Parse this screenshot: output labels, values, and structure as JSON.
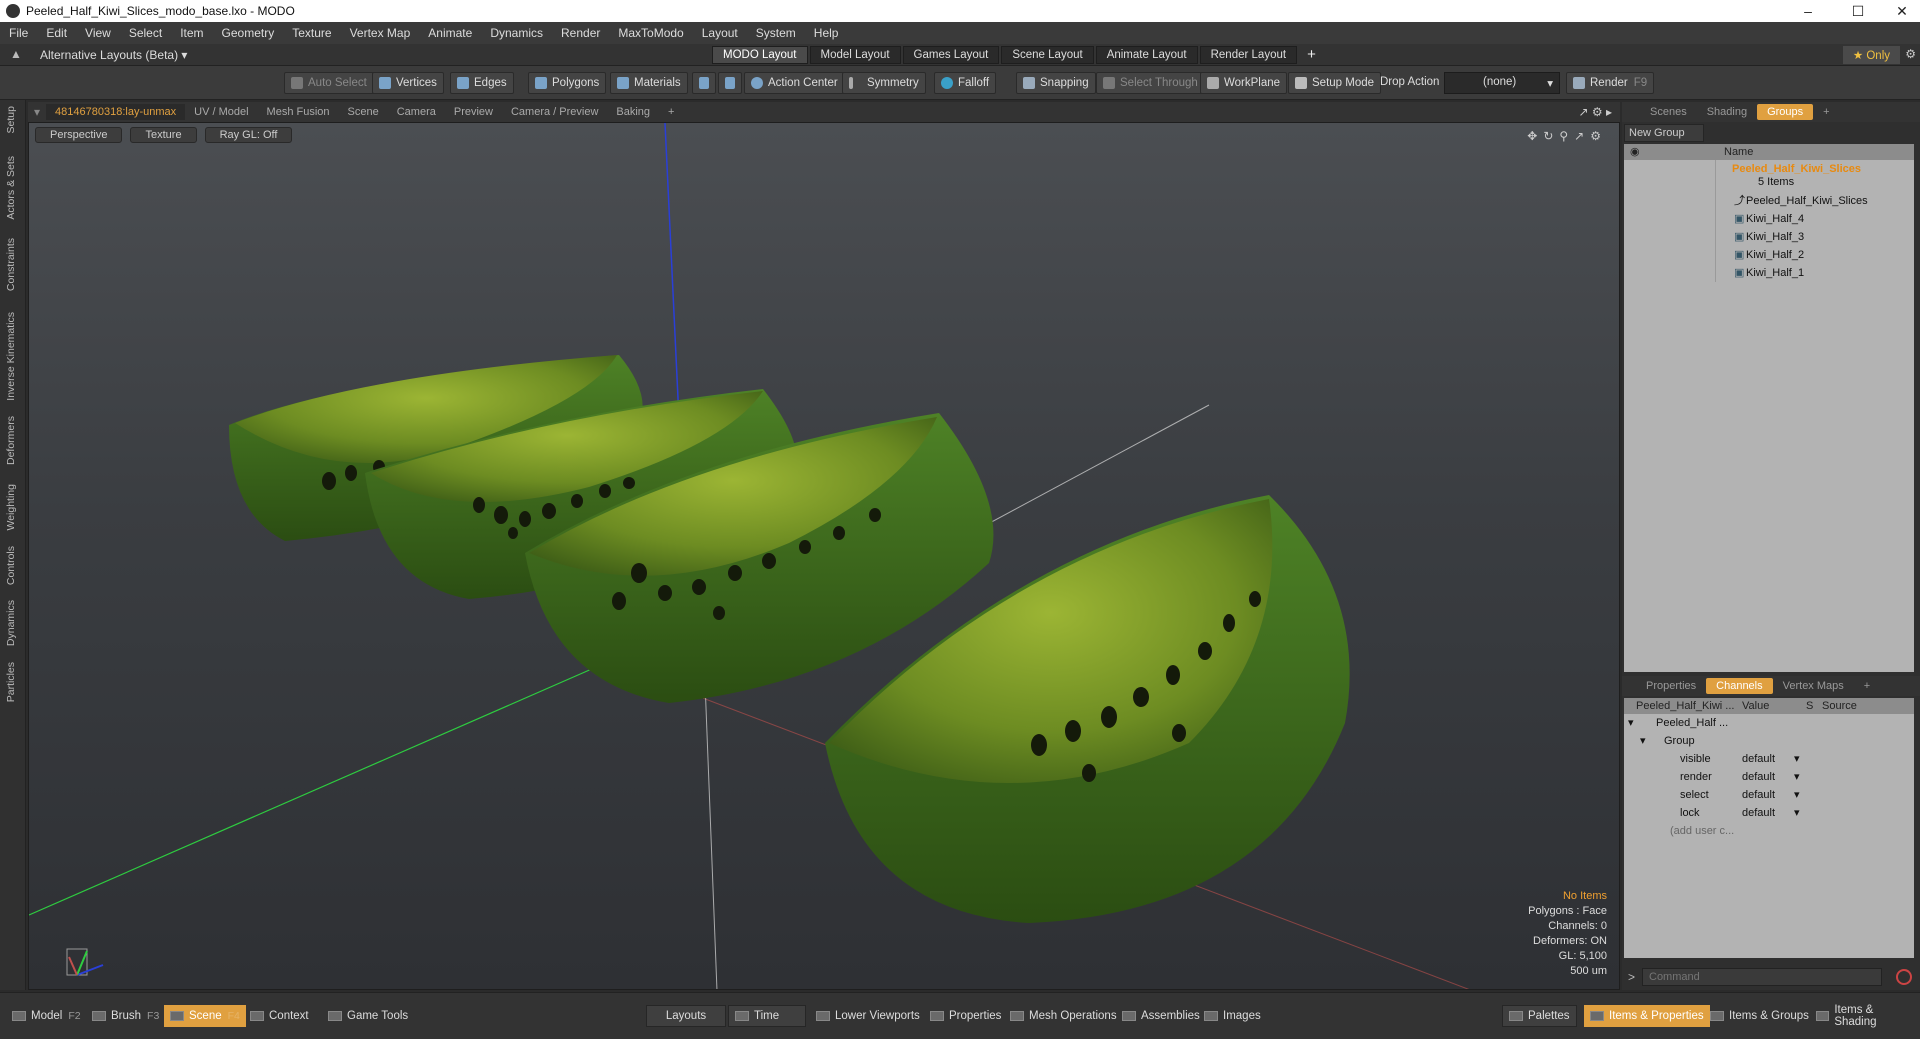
{
  "window": {
    "title": "Peeled_Half_Kiwi_Slices_modo_base.lxo - MODO",
    "minimize": "–",
    "maximize": "☐",
    "close": "✕"
  },
  "menu": [
    "File",
    "Edit",
    "View",
    "Select",
    "Item",
    "Geometry",
    "Texture",
    "Vertex Map",
    "Animate",
    "Dynamics",
    "Render",
    "MaxToModo",
    "Layout",
    "System",
    "Help"
  ],
  "layoutbar": {
    "alternative": "Alternative Layouts (Beta) ▾",
    "tabs": [
      "MODO Layout",
      "Model Layout",
      "Games Layout",
      "Scene Layout",
      "Animate Layout",
      "Render Layout"
    ],
    "add": "+",
    "only": "★ Only"
  },
  "toolbar": {
    "auto_select": "Auto Select",
    "vertices": "Vertices",
    "edges": "Edges",
    "polygons": "Polygons",
    "materials": "Materials",
    "action_center": "Action Center",
    "symmetry": "Symmetry",
    "falloff": "Falloff",
    "snapping": "Snapping",
    "select_through": "Select Through",
    "workplane": "WorkPlane",
    "setup_mode": "Setup Mode",
    "drop_action": "Drop Action",
    "drop_value": "(none)",
    "render": "Render",
    "render_key": "F9"
  },
  "lefttabs": [
    "Setup",
    "Actors & Sets",
    "Constraints",
    "Inverse Kinematics",
    "Deformers",
    "Weighting",
    "Controls",
    "Dynamics",
    "Particles"
  ],
  "viewport_tabs": [
    "48146780318:lay-unmax",
    "UV / Model",
    "Mesh Fusion",
    "Scene",
    "Camera",
    "Preview",
    "Camera / Preview",
    "Baking",
    "+"
  ],
  "viewport": {
    "view": "Perspective",
    "shading": "Texture",
    "raygl": "Ray GL: Off",
    "info": {
      "items": "No Items",
      "polygons": "Polygons : Face",
      "channels": "Channels: 0",
      "deformers": "Deformers: ON",
      "gl": "GL: 5,100",
      "scale": "500 um"
    }
  },
  "scene_panel": {
    "tabs": [
      "Scenes",
      "Shading",
      "Groups",
      "+"
    ],
    "new_group": "New Group",
    "name_header": "Name",
    "group_name": "Peeled_Half_Kiwi_Slices",
    "group_count": "5 Items",
    "children": [
      "Peeled_Half_Kiwi_Slices",
      "Kiwi_Half_4",
      "Kiwi_Half_3",
      "Kiwi_Half_2",
      "Kiwi_Half_1"
    ]
  },
  "props_panel": {
    "tabs": [
      "Properties",
      "Channels",
      "Vertex Maps",
      "+"
    ],
    "headers": {
      "name": "Peeled_Half_Kiwi ...",
      "value": "Value",
      "s": "S",
      "source": "Source"
    },
    "item": "Peeled_Half ...",
    "group": "Group",
    "rows": [
      {
        "name": "visible",
        "value": "default"
      },
      {
        "name": "render",
        "value": "default"
      },
      {
        "name": "select",
        "value": "default"
      },
      {
        "name": "lock",
        "value": "default"
      }
    ],
    "add_user": "(add user c...",
    "command_placeholder": "Command",
    "command_prompt": ">"
  },
  "statusbar": {
    "model": "Model",
    "model_key": "F2",
    "brush": "Brush",
    "brush_key": "F3",
    "scene": "Scene",
    "scene_key": "F4",
    "context": "Context",
    "game_tools": "Game Tools",
    "layouts": "Layouts",
    "time": "Time",
    "lower_viewports": "Lower Viewports",
    "properties": "Properties",
    "mesh_operations": "Mesh Operations",
    "assemblies": "Assemblies",
    "images": "Images",
    "palettes": "Palettes",
    "items_properties": "Items & Properties",
    "items_groups": "Items & Groups",
    "items_shading": "Items & Shading"
  },
  "colors": {
    "accent": "#e0a040",
    "kiwi_skin": "#3f6e1c",
    "kiwi_flesh": "#8fae2a",
    "kiwi_seed": "#141a0a",
    "axis_x": "#c0504d",
    "axis_y": "#2ecc40",
    "axis_z": "#2a3fd8"
  }
}
